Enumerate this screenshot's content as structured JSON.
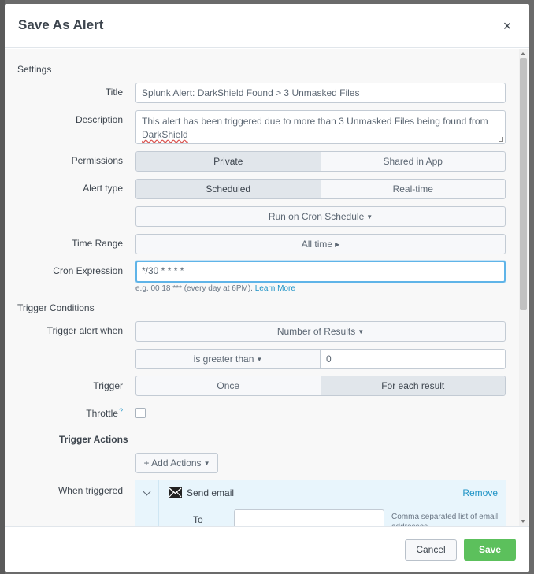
{
  "modal": {
    "title": "Save As Alert",
    "close_symbol": "×"
  },
  "settings": {
    "section_label": "Settings",
    "title_label": "Title",
    "title_value": "Splunk Alert: DarkShield Found > 3 Unmasked Files",
    "description_label": "Description",
    "description_line1": "This alert has been triggered due to more than 3 Unmasked Files being found from",
    "description_line2": "DarkShield",
    "permissions_label": "Permissions",
    "permissions_options": [
      "Private",
      "Shared in App"
    ],
    "permissions_selected": "Private",
    "alert_type_label": "Alert type",
    "alert_type_options": [
      "Scheduled",
      "Real-time"
    ],
    "alert_type_selected": "Scheduled",
    "schedule_dropdown": "Run on Cron Schedule",
    "time_range_label": "Time Range",
    "time_range_value": "All time",
    "cron_label": "Cron Expression",
    "cron_value": "*/30 * * * *",
    "cron_help": "e.g. 00 18 *** (every day at 6PM).",
    "cron_help_link": "Learn More"
  },
  "trigger_conditions": {
    "section_label": "Trigger Conditions",
    "trigger_when_label": "Trigger alert when",
    "trigger_when_value": "Number of Results",
    "comparison_value": "is greater than",
    "threshold_value": "0",
    "trigger_label": "Trigger",
    "trigger_options": [
      "Once",
      "For each result"
    ],
    "trigger_selected": "For each result",
    "throttle_label": "Throttle",
    "throttle_help": "?",
    "throttle_checked": false
  },
  "trigger_actions": {
    "section_label": "Trigger Actions",
    "add_actions_label": "+ Add Actions",
    "when_triggered_label": "When triggered",
    "action_name": "Send email",
    "action_icon": "envelope-icon",
    "remove_label": "Remove",
    "to_label": "To",
    "to_value": "",
    "to_help": "Comma separated list of email addresses."
  },
  "footer": {
    "cancel_label": "Cancel",
    "save_label": "Save"
  },
  "colors": {
    "save_button": "#5cc05c",
    "link": "#1e93c6",
    "focus_border": "#5fb4e8",
    "action_panel_bg": "#e8f5fc"
  }
}
